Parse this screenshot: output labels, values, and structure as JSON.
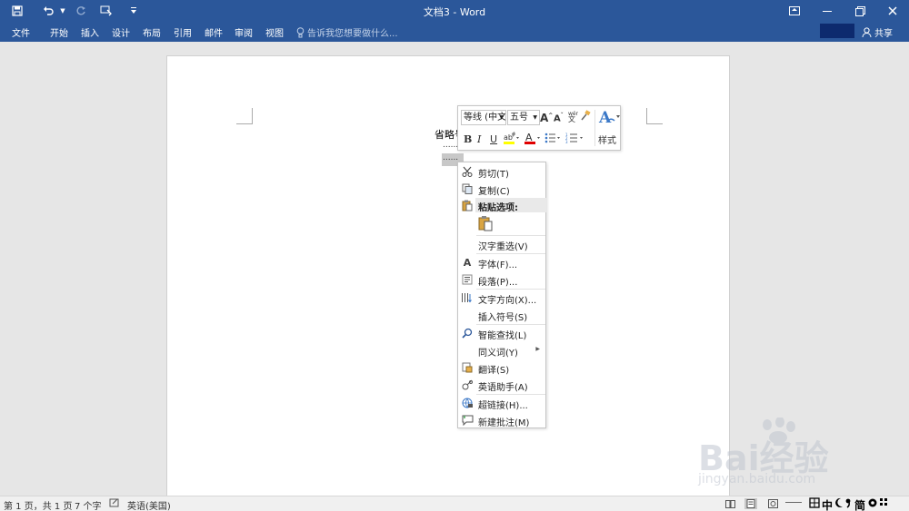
{
  "titlebar": {
    "title": "文档3 - Word",
    "qat_icons": [
      "save-icon",
      "undo-icon",
      "redo-icon",
      "touch-mode-icon",
      "customize-icon"
    ]
  },
  "ribbon": {
    "tabs": [
      "文件",
      "开始",
      "插入",
      "设计",
      "布局",
      "引用",
      "邮件",
      "审阅",
      "视图"
    ],
    "tell_me": "告诉我您想要做什么...",
    "share": "共享"
  },
  "document": {
    "text_line": "省略号",
    "dots_line1": "......",
    "dots_line2": "......"
  },
  "mini_toolbar": {
    "font": "等线 (中文",
    "size": "五号",
    "styles_label": "样式"
  },
  "context_menu": {
    "items": [
      {
        "label": "剪切(T)",
        "icon": "scissors-icon"
      },
      {
        "label": "复制(C)",
        "icon": "copy-icon"
      },
      {
        "label": "粘贴选项:",
        "icon": "paste-icon"
      },
      {
        "label": "汉字重选(V)",
        "icon": ""
      },
      {
        "label": "字体(F)...",
        "icon": "font-icon"
      },
      {
        "label": "段落(P)...",
        "icon": "paragraph-icon"
      },
      {
        "label": "文字方向(X)...",
        "icon": "text-direction-icon"
      },
      {
        "label": "插入符号(S)",
        "icon": ""
      },
      {
        "label": "智能查找(L)",
        "icon": "smart-lookup-icon"
      },
      {
        "label": "同义词(Y)",
        "icon": ""
      },
      {
        "label": "翻译(S)",
        "icon": "translate-icon"
      },
      {
        "label": "英语助手(A)",
        "icon": "english-assistant-icon"
      },
      {
        "label": "超链接(H)...",
        "icon": "hyperlink-icon"
      },
      {
        "label": "新建批注(M)",
        "icon": "comment-icon"
      }
    ]
  },
  "statusbar": {
    "page": "第 1 页，共 1 页",
    "words": "7 个字",
    "language": "英语(美国)"
  },
  "ime": [
    "中",
    "简"
  ],
  "watermark": {
    "brand": "Bai经验",
    "url": "jingyan.baidu.com"
  },
  "colors": {
    "accent": "#2b579a",
    "highlight_bar": "#ffff00",
    "font_color_bar": "#e00000"
  }
}
